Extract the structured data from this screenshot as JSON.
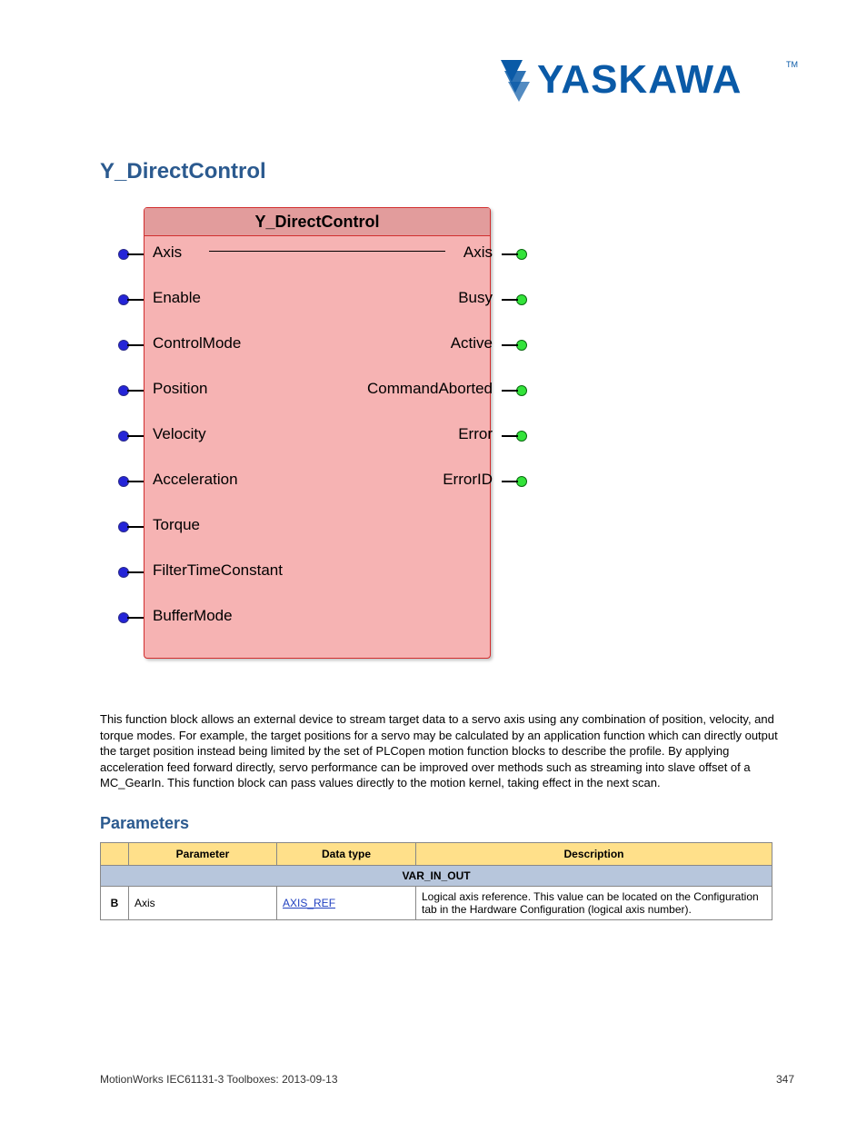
{
  "logo_text": "YASKAWA",
  "section_title": "Y_DirectControl",
  "fb": {
    "title": "Y_DirectControl",
    "inputs": [
      "Axis",
      "Enable",
      "ControlMode",
      "Position",
      "Velocity",
      "Acceleration",
      "Torque",
      "FilterTimeConstant",
      "BufferMode"
    ],
    "outputs": [
      "Axis",
      "Busy",
      "Active",
      "CommandAborted",
      "Error",
      "ErrorID"
    ]
  },
  "body_text": "This function block allows an external device to stream target data to a servo axis using any combination of position, velocity, and torque modes. For example, the target positions for a servo may be calculated by an application function which can directly output the target position instead being limited by the set of PLCopen motion function blocks to describe the profile. By applying acceleration feed forward directly, servo performance can be improved over methods such as streaming into slave offset of a MC_GearIn. This function block can pass values directly to the motion kernel, taking effect in the next scan.",
  "params_heading": "Parameters",
  "table": {
    "columns": [
      "Parameter",
      "Data type",
      "Description"
    ],
    "subheader": "VAR_IN_OUT",
    "row": {
      "side": "B",
      "parameter": "Axis",
      "datatype": "AXIS_REF",
      "description": "Logical axis reference. This value can be located on the Configuration tab in the Hardware Configuration (logical axis number)."
    }
  },
  "footer": {
    "left": "MotionWorks IEC61131-3 Toolboxes: 2013-09-13",
    "right": "347"
  }
}
